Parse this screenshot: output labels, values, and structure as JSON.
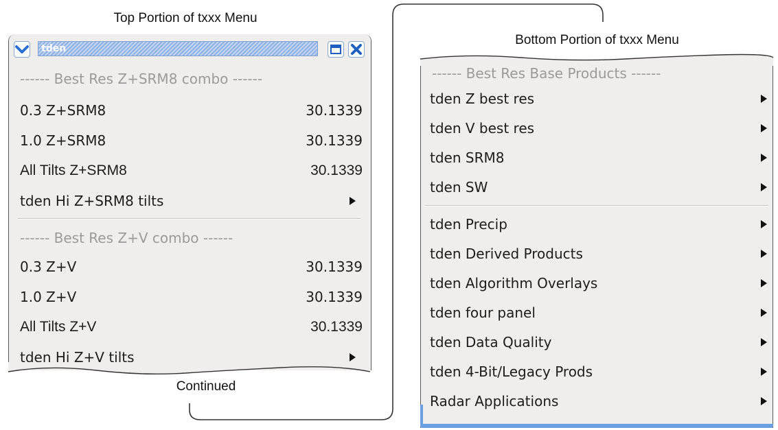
{
  "captions": {
    "top": "Top Portion of txxx Menu",
    "bottom": "Bottom Portion of txxx Menu",
    "continued": "Continued"
  },
  "top_window": {
    "title": "tden",
    "icons": {
      "menu": "chevron-down-icon",
      "maximize": "maximize-icon",
      "close": "close-icon"
    },
    "sections": [
      {
        "header": "------ Best Res Z+SRM8 combo ------",
        "items": [
          {
            "label": "0.3 Z+SRM8",
            "value": "30.1339"
          },
          {
            "label": "1.0 Z+SRM8",
            "value": "30.1339"
          },
          {
            "label": "All Tilts Z+SRM8",
            "value": "30.1339"
          },
          {
            "label": "tden Hi Z+SRM8 tilts",
            "submenu": true
          }
        ]
      },
      {
        "header": "------ Best Res Z+V combo ------",
        "items": [
          {
            "label": "0.3 Z+V",
            "value": "30.1339"
          },
          {
            "label": "1.0 Z+V",
            "value": "30.1339"
          },
          {
            "label": "All Tilts Z+V",
            "value": "30.1339"
          },
          {
            "label": "tden Hi Z+V tilts",
            "submenu": true
          }
        ]
      }
    ]
  },
  "bottom_window": {
    "header": "------ Best Res Base Products ------",
    "group_one": [
      {
        "label": "tden Z best res",
        "submenu": true
      },
      {
        "label": "tden V best res",
        "submenu": true
      },
      {
        "label": "tden SRM8",
        "submenu": true
      },
      {
        "label": "tden SW",
        "submenu": true
      }
    ],
    "group_two": [
      {
        "label": "tden Precip",
        "submenu": true
      },
      {
        "label": "tden Derived Products",
        "submenu": true
      },
      {
        "label": "tden Algorithm Overlays",
        "submenu": true
      },
      {
        "label": "tden four panel",
        "submenu": true
      },
      {
        "label": "tden Data Quality",
        "submenu": true
      },
      {
        "label": "tden 4-Bit/Legacy Prods",
        "submenu": true
      },
      {
        "label": "Radar Applications",
        "submenu": true
      }
    ]
  },
  "colors": {
    "menu_background": "#efeeec",
    "header_text": "#9a9a9a",
    "titlebar_blue": "#a9c4ec",
    "accent_blue": "#2a6fd1"
  }
}
